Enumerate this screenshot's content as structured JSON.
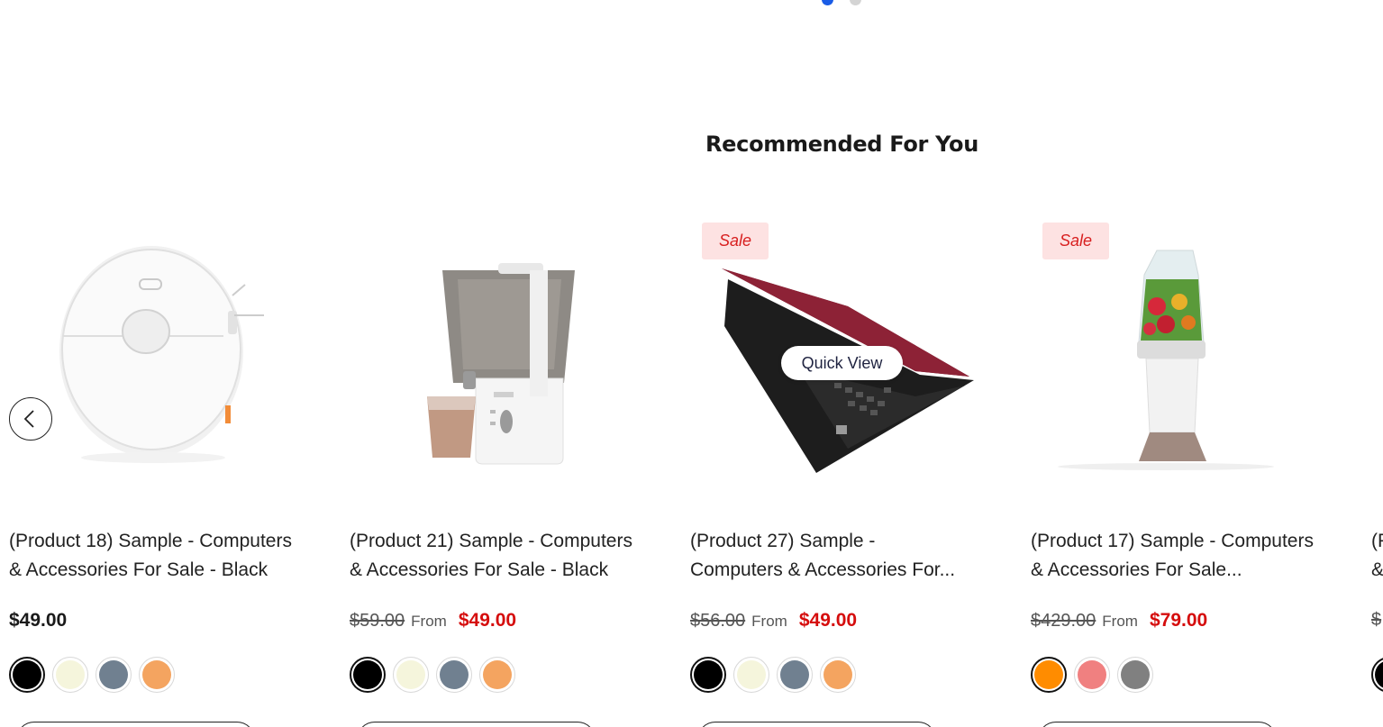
{
  "carousel": {
    "dots": 2,
    "active_dot": 0
  },
  "section": {
    "title": "Recommended For You"
  },
  "nav": {
    "prev_icon": "chevron-left-icon"
  },
  "products": [
    {
      "title": "(Product 18) Sample - Computers\n& Accessories For Sale - Black",
      "image": "robot-vacuum",
      "sale_badge": "",
      "price": "$49.00",
      "compare_price": "",
      "from_label": "",
      "swatches": [
        "#000000",
        "#f5f5dc",
        "#708090",
        "#f4a460"
      ],
      "selected_swatch": 0
    },
    {
      "title": "(Product 21) Sample - Computers\n& Accessories For Sale - Black",
      "image": "juicer",
      "sale_badge": "",
      "price": "$49.00",
      "compare_price": "$59.00",
      "from_label": "From",
      "swatches": [
        "#000000",
        "#f5f5dc",
        "#708090",
        "#f4a460"
      ],
      "selected_swatch": 0
    },
    {
      "title": "(Product 27) Sample -\nComputers & Accessories For...",
      "image": "laptop",
      "sale_badge": "Sale",
      "quick_view": "Quick View",
      "price": "$49.00",
      "compare_price": "$56.00",
      "from_label": "From",
      "swatches": [
        "#000000",
        "#f5f5dc",
        "#708090",
        "#f4a460"
      ],
      "selected_swatch": 0
    },
    {
      "title": "(Product 17) Sample - Computers\n& Accessories For Sale...",
      "image": "blender",
      "sale_badge": "Sale",
      "price": "$79.00",
      "compare_price": "$429.00",
      "from_label": "From",
      "swatches": [
        "#ff8c00",
        "#f08080",
        "#808080"
      ],
      "selected_swatch": 0
    },
    {
      "title": "(P\n&",
      "image": "partial",
      "sale_badge": "",
      "price": "",
      "compare_price": "$",
      "from_label": "",
      "swatches": [
        "#000000"
      ],
      "selected_swatch": 0
    }
  ],
  "colors": {
    "accent_dot": "#1a5ce6",
    "sale_price": "#d50d0d",
    "sale_badge_bg": "#fde2e2"
  }
}
